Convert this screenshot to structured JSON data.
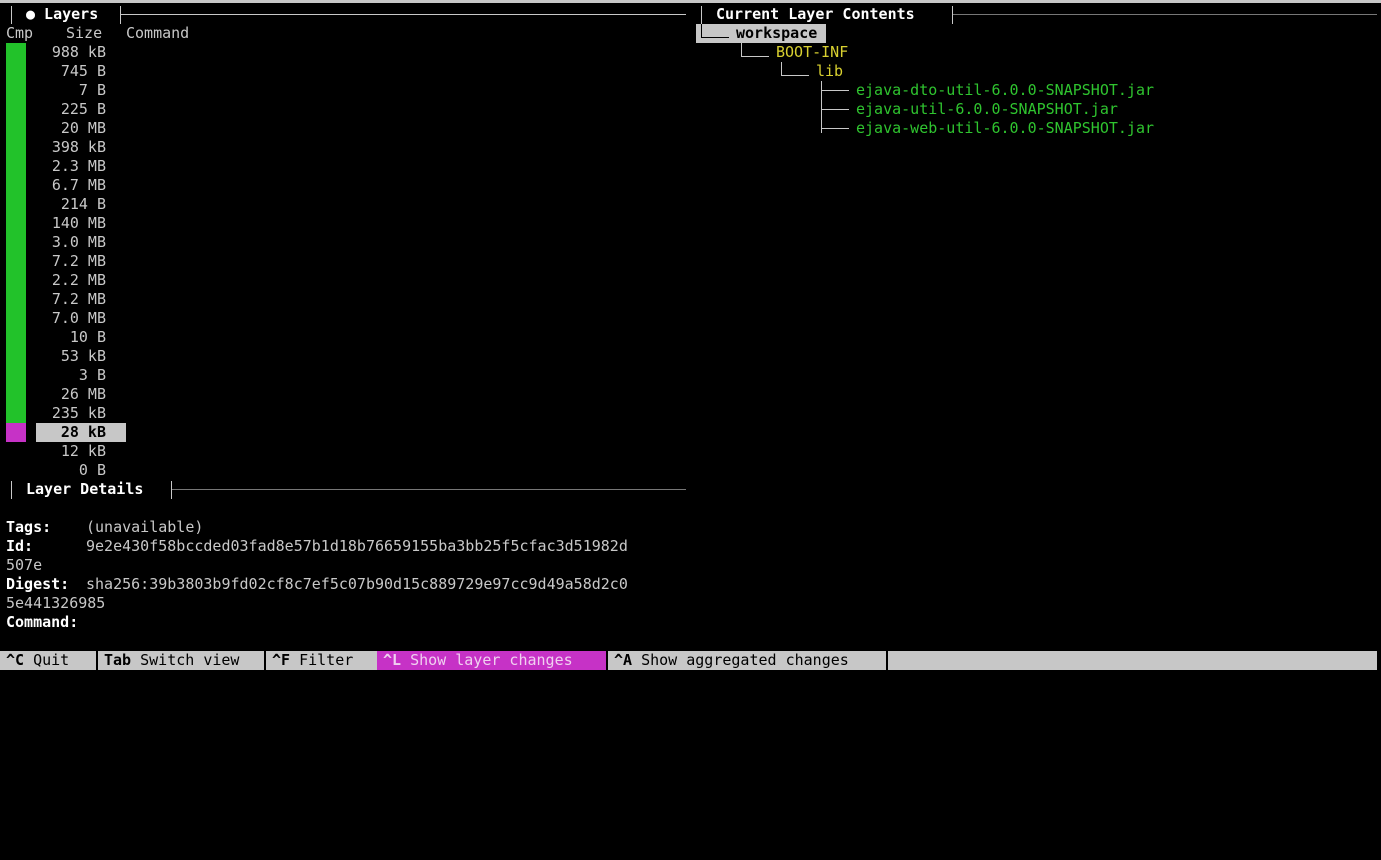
{
  "layers_panel": {
    "title": "● Layers",
    "columns": {
      "cmp": "Cmp",
      "size": "Size",
      "command": "Command"
    },
    "rows": [
      {
        "size": "988 kB",
        "color": "#22c22a"
      },
      {
        "size": "745 B",
        "color": "#22c22a"
      },
      {
        "size": "7 B",
        "color": "#22c22a"
      },
      {
        "size": "225 B",
        "color": "#22c22a"
      },
      {
        "size": "20 MB",
        "color": "#22c22a"
      },
      {
        "size": "398 kB",
        "color": "#22c22a"
      },
      {
        "size": "2.3 MB",
        "color": "#22c22a"
      },
      {
        "size": "6.7 MB",
        "color": "#22c22a"
      },
      {
        "size": "214 B",
        "color": "#22c22a"
      },
      {
        "size": "140 MB",
        "color": "#22c22a"
      },
      {
        "size": "3.0 MB",
        "color": "#22c22a"
      },
      {
        "size": "7.2 MB",
        "color": "#22c22a"
      },
      {
        "size": "2.2 MB",
        "color": "#22c22a"
      },
      {
        "size": "7.2 MB",
        "color": "#22c22a"
      },
      {
        "size": "7.0 MB",
        "color": "#22c22a"
      },
      {
        "size": "10 B",
        "color": "#22c22a"
      },
      {
        "size": "53 kB",
        "color": "#22c22a"
      },
      {
        "size": "3 B",
        "color": "#22c22a"
      },
      {
        "size": "26 MB",
        "color": "#22c22a"
      },
      {
        "size": "235 kB",
        "color": "#22c22a"
      },
      {
        "size": "28 kB",
        "color": "#c632c6",
        "selected": true
      },
      {
        "size": "12 kB",
        "color": null
      },
      {
        "size": "0 B",
        "color": null
      }
    ]
  },
  "layer_details": {
    "title": "Layer Details",
    "tags_label": "Tags:",
    "tags_value": "(unavailable)",
    "id_label": "Id:",
    "id_value_line1": "9e2e430f58bccded03fad8e57b1d18b76659155ba3bb25f5cfac3d51982d",
    "id_value_line2": "507e",
    "digest_label": "Digest:",
    "digest_value_line1": "sha256:39b3803b9fd02cf8c7ef5c07b90d15c889729e97cc9d49a58d2c0",
    "digest_value_line2": "5e441326985",
    "command_label": "Command:"
  },
  "contents_panel": {
    "title": "Current Layer Contents",
    "tree": [
      {
        "name": "workspace",
        "type": "dir",
        "depth": 0,
        "selected": true
      },
      {
        "name": "BOOT-INF",
        "type": "dir-modified",
        "depth": 1
      },
      {
        "name": "lib",
        "type": "dir-modified",
        "depth": 2
      },
      {
        "name": "ejava-dto-util-6.0.0-SNAPSHOT.jar",
        "type": "added",
        "depth": 3
      },
      {
        "name": "ejava-util-6.0.0-SNAPSHOT.jar",
        "type": "added",
        "depth": 3
      },
      {
        "name": "ejava-web-util-6.0.0-SNAPSHOT.jar",
        "type": "added",
        "depth": 3
      }
    ]
  },
  "status_bar": [
    {
      "key": "^C",
      "label": "Quit",
      "active": false
    },
    {
      "key": "Tab",
      "label": "Switch view",
      "active": false
    },
    {
      "key": "^F",
      "label": "Filter",
      "active": false
    },
    {
      "key": "^L",
      "label": "Show layer changes",
      "active": true
    },
    {
      "key": "^A",
      "label": "Show aggregated changes",
      "active": false
    }
  ],
  "colors": {
    "added": "#2fc42f",
    "modified": "#d8d030",
    "active_key": "#c632c6",
    "selection": "#c7c7c7"
  }
}
